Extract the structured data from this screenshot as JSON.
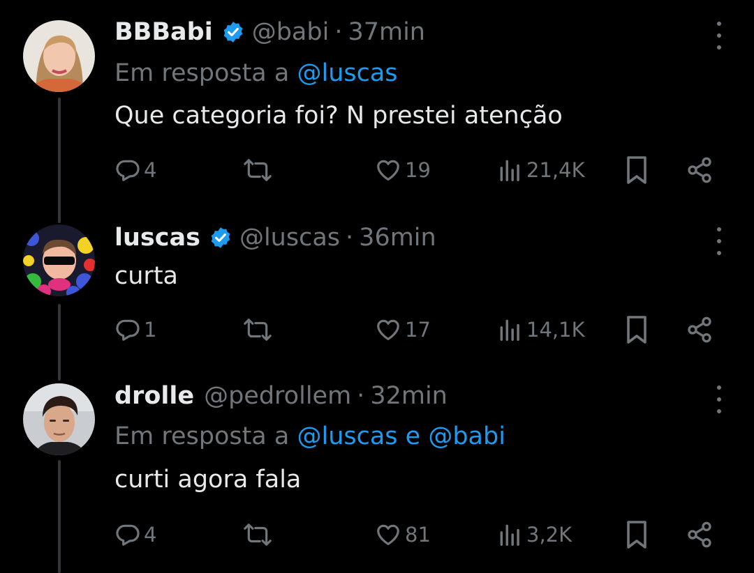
{
  "colors": {
    "background": "#000000",
    "text": "#e7e9ea",
    "secondary": "#71767b",
    "accent": "#1d9bf0",
    "thread_line": "#333639"
  },
  "tweets": [
    {
      "display_name": "BBBabi",
      "verified": true,
      "handle": "@babi",
      "separator": "·",
      "time": "37min",
      "reply_prefix": "Em resposta a ",
      "reply_mentions": "@luscas",
      "text": "Que categoria foi? N prestei atenção",
      "replies": "4",
      "likes": "19",
      "views": "21,4K",
      "icons": [
        "reply-icon",
        "retweet-icon",
        "like-icon",
        "views-icon",
        "bookmark-icon",
        "share-icon",
        "more-icon",
        "verified-badge-icon"
      ]
    },
    {
      "display_name": "luscas",
      "verified": true,
      "handle": "@luscas",
      "separator": "·",
      "time": "36min",
      "text": "curta",
      "replies": "1",
      "likes": "17",
      "views": "14,1K"
    },
    {
      "display_name": "drolle",
      "verified": false,
      "handle": "@pedrollem",
      "separator": "·",
      "time": "32min",
      "reply_prefix": "Em resposta a ",
      "reply_mentions": "@luscas e @babi",
      "text": "curti agora fala",
      "replies": "4",
      "likes": "81",
      "views": "3,2K"
    }
  ]
}
